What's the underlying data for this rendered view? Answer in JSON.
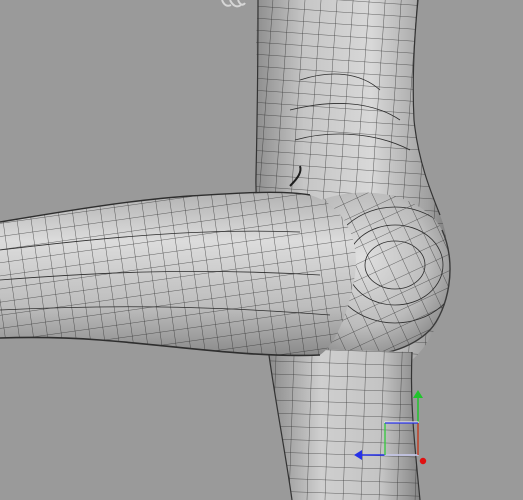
{
  "viewport": {
    "background_color": "#9a9a9a",
    "mesh_fill_color": "#c8c8c8",
    "wire_color": "#2c2c2c",
    "hand_color": "#d6d6d6"
  },
  "gizmo": {
    "x_axis_color": "#e0151b",
    "y_axis_color": "#21c42c",
    "z_axis_color": "#2631e8",
    "pivot_color": "#e01010"
  },
  "icons": {
    "manipulator": "move-tool-gizmo-icon"
  }
}
